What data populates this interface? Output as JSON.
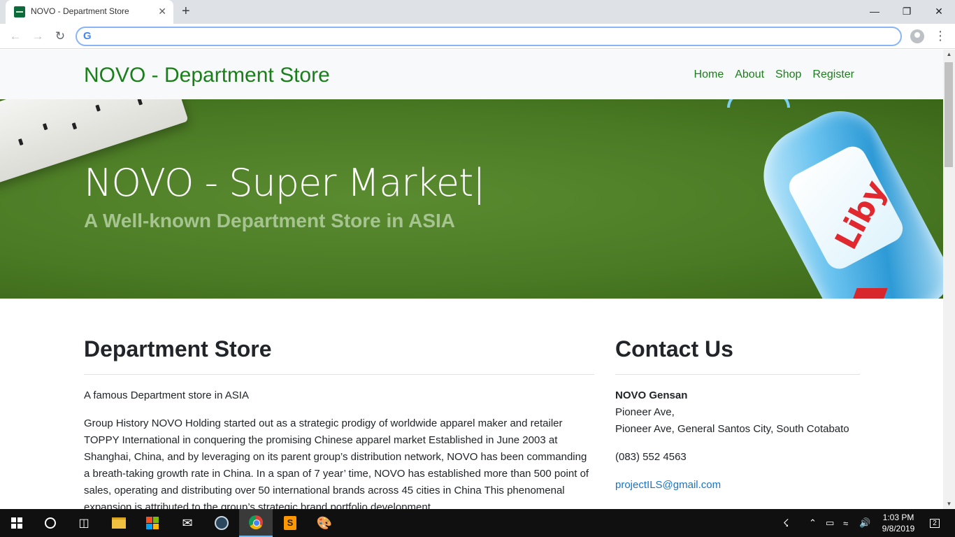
{
  "browser": {
    "tab_title": "NOVO - Department Store",
    "new_tab": "+",
    "close_tab": "✕",
    "omnibox_value": "",
    "window": {
      "minimize": "—",
      "restore": "❐",
      "close": "✕"
    }
  },
  "site": {
    "brand": "NOVO - Department Store",
    "nav": [
      "Home",
      "About",
      "Shop",
      "Register"
    ],
    "hero": {
      "title": "NOVO - Super Market|",
      "subtitle": "A Well-known Department Store in ASIA",
      "product_brand": "Liby"
    },
    "main": {
      "heading": "Department Store",
      "intro": "A famous Department store in ASIA",
      "history": "Group History NOVO Holding started out as a strategic prodigy of worldwide apparel maker and retailer TOPPY International in conquering the promising Chinese apparel market Established in June 2003 at Shanghai, China, and by leveraging on its parent group’s distribution network, NOVO has been commanding a breath-taking growth rate in China. In a span of 7 year’ time, NOVO has established more than 500 point of sales, operating and distributing over 50 international brands across 45 cities in China This phenomenal expansion is attributed to the group’s strategic brand portfolio development"
    },
    "contact": {
      "heading": "Contact Us",
      "name": "NOVO Gensan",
      "address_line1": "Pioneer Ave,",
      "address_line2": "Pioneer Ave, General Santos City, South Cotabato",
      "phone": "(083) 552 4563",
      "email": "projectILS@gmail.com"
    }
  },
  "taskbar": {
    "time": "1:03 PM",
    "date": "9/8/2019",
    "notifications": "2"
  },
  "colors": {
    "brand_green": "#1a7f1a",
    "hero_green": "#4a7a24",
    "hero_subtitle": "#a5c48f",
    "link_blue": "#1a73c8"
  }
}
